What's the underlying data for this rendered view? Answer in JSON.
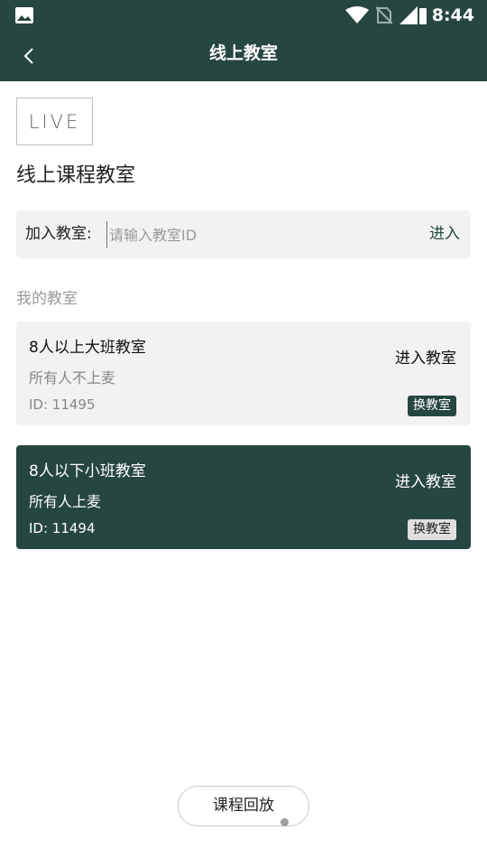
{
  "status_bar": {
    "time": "8:44",
    "icons": [
      "gallery-icon",
      "wifi-icon",
      "no-sim-icon",
      "signal-icon",
      "battery-icon"
    ]
  },
  "header": {
    "title": "线上教室",
    "back_icon": "chevron-left-icon"
  },
  "logo": {
    "text": "LIVE"
  },
  "main": {
    "heading": "线上课程教室",
    "join": {
      "label": "加入教室:",
      "placeholder": "请输入教室ID",
      "value": "",
      "enter_label": "进入"
    },
    "my_rooms_label": "我的教室",
    "rooms": [
      {
        "name": "8人以上大班教室",
        "desc": "所有人不上麦",
        "id_text": "ID: 11495",
        "enter_label": "进入教室",
        "switch_label": "换教室",
        "selected": false
      },
      {
        "name": "8人以下小班教室",
        "desc": "所有人上麦",
        "id_text": "ID: 11494",
        "enter_label": "进入教室",
        "switch_label": "换教室",
        "selected": true
      }
    ]
  },
  "footer": {
    "replay_label": "课程回放"
  },
  "colors": {
    "primary": "#264641",
    "card_bg": "#f2f2f2",
    "muted_text": "#9a9a9a"
  }
}
